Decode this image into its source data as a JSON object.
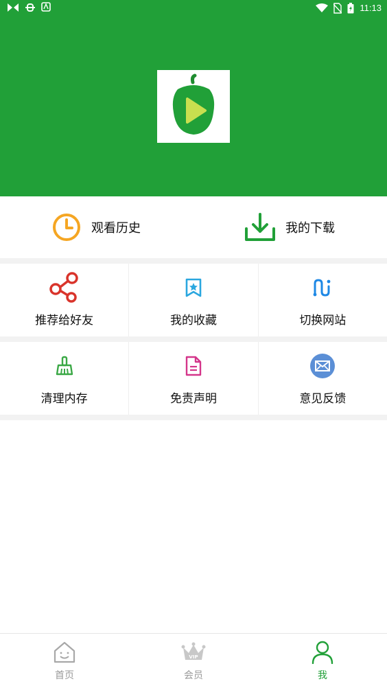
{
  "status_bar": {
    "time": "11:13",
    "left_icons": [
      "butterfly-icon",
      "bug-icon",
      "keyboard-icon"
    ],
    "right_icons": [
      "wifi-icon",
      "no-sim-icon",
      "battery-charging-icon"
    ]
  },
  "colors": {
    "brand_green": "#21a038",
    "history_orange": "#f5a623",
    "share_red": "#d9342b",
    "star_blue": "#2aa7df",
    "switch_blue": "#1e88e5",
    "clean_green": "#3aa845",
    "doc_pink": "#d4358a",
    "mail_blue": "#5b8fd6"
  },
  "quick_actions": [
    {
      "label": "观看历史",
      "icon": "clock-icon"
    },
    {
      "label": "我的下载",
      "icon": "download-icon"
    }
  ],
  "grid": [
    {
      "label": "推荐给好友",
      "icon": "share-icon"
    },
    {
      "label": "我的收藏",
      "icon": "bookmark-star-icon"
    },
    {
      "label": "切换网站",
      "icon": "switch-icon"
    },
    {
      "label": "清理内存",
      "icon": "broom-icon"
    },
    {
      "label": "免责声明",
      "icon": "document-icon"
    },
    {
      "label": "意见反馈",
      "icon": "mail-icon"
    }
  ],
  "bottom_nav": [
    {
      "label": "首页",
      "icon": "home-icon",
      "active": false
    },
    {
      "label": "会员",
      "icon": "vip-crown-icon",
      "active": false
    },
    {
      "label": "我",
      "icon": "person-icon",
      "active": true
    }
  ]
}
